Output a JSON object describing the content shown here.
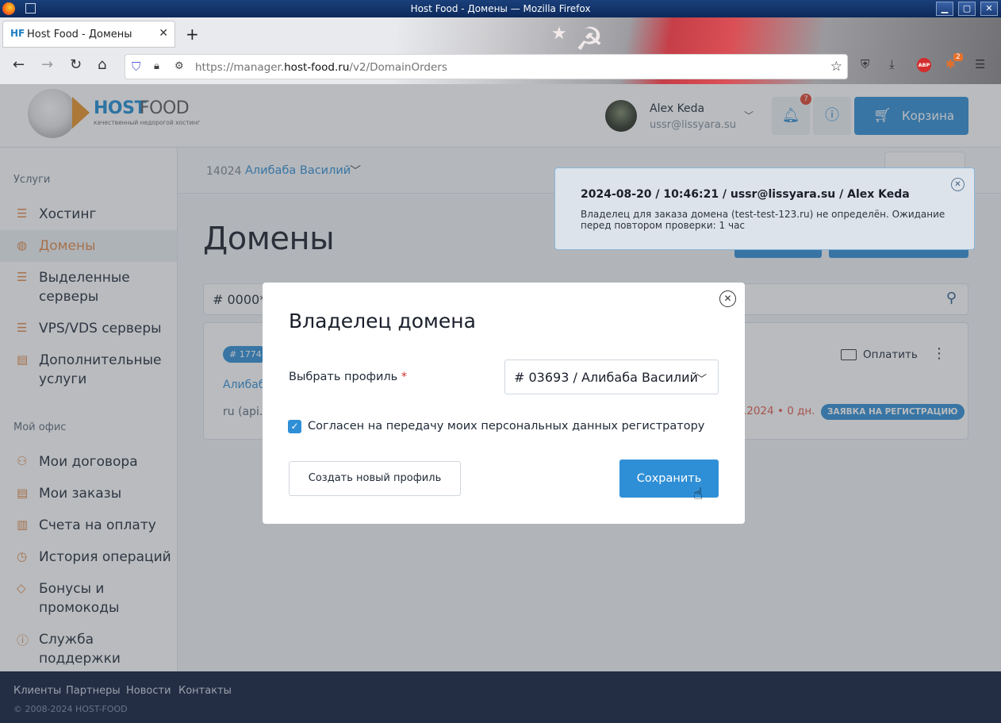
{
  "window": {
    "title": "Host Food - Домены — Mozilla Firefox",
    "controls": [
      "minimize",
      "maximize",
      "close"
    ]
  },
  "browser": {
    "tab_title": "Host Food - Домены",
    "tab_favicon": "HF",
    "url_prefix": "https://manager.",
    "url_host": "host-food.ru",
    "url_path": "/v2/DomainOrders",
    "extensions": {
      "abp_label": "ABP",
      "ext_badge": "2"
    }
  },
  "site_header": {
    "logo": {
      "host": "HOST",
      "food": "FOOD",
      "tagline": "качественный недорогой хостинг"
    },
    "user": {
      "name": "Alex Keda",
      "email": "ussr@lissyara.su"
    },
    "notifications_count": "7",
    "cart_label": "Корзина"
  },
  "sidebar": {
    "sections": [
      {
        "title": "Услуги",
        "items": [
          {
            "label": "Хостинг",
            "icon": "server-stack-icon",
            "active": false
          },
          {
            "label": "Домены",
            "icon": "globe-icon",
            "active": true
          },
          {
            "label": "Выделенные серверы",
            "icon": "server-icon",
            "active": false
          },
          {
            "label": "VPS/VDS серверы",
            "icon": "cloud-server-icon",
            "active": false
          },
          {
            "label": "Дополнительные услуги",
            "icon": "addon-icon",
            "active": false
          }
        ]
      },
      {
        "title": "Мой офис",
        "items": [
          {
            "label": "Мои договора",
            "icon": "contract-icon"
          },
          {
            "label": "Мои заказы",
            "icon": "orders-icon"
          },
          {
            "label": "Счета на оплату",
            "icon": "invoice-icon"
          },
          {
            "label": "История операций",
            "icon": "history-icon"
          },
          {
            "label": "Бонусы и промокоды",
            "icon": "tag-icon"
          },
          {
            "label": "Служба поддержки",
            "icon": "help-icon"
          }
        ]
      }
    ]
  },
  "main": {
    "contract_id": "14024",
    "contract_name": "Алибаба Василий",
    "page_title": "Домены",
    "search_value": "# 0000*",
    "order": {
      "badge": "# 1774",
      "owner": "Алибаб",
      "domain": "ru (api.",
      "pay_label": "Оплатить",
      "date_text": ".2024 • 0 дн.",
      "status": "ЗАЯВКА НА РЕГИСТРАЦИЮ"
    }
  },
  "toast": {
    "header": "2024-08-20 / 10:46:21 / ussr@lissyara.su / Alex Keda",
    "body": "Владелец для заказа домена (test-test-123.ru) не определён. Ожидание перед повтором проверки: 1 час"
  },
  "modal": {
    "title": "Владелец домена",
    "profile_label": "Выбрать профиль",
    "required_mark": "*",
    "profile_value": "# 03693 / Алибаба Василий",
    "consent_checked": true,
    "consent_label": "Согласен на передачу моих персональных данных регистратору",
    "create_button": "Создать новый профиль",
    "save_button": "Сохранить"
  },
  "footer": {
    "links": [
      "Клиенты",
      "Партнеры",
      "Новости",
      "Контакты"
    ],
    "copyright": "© 2008-2024 HOST-FOOD"
  },
  "colors": {
    "accent": "#2f8fd6",
    "sidebar_active": "#e08a4a",
    "footer_bg": "#0e1a3a",
    "danger": "#e2584a"
  }
}
